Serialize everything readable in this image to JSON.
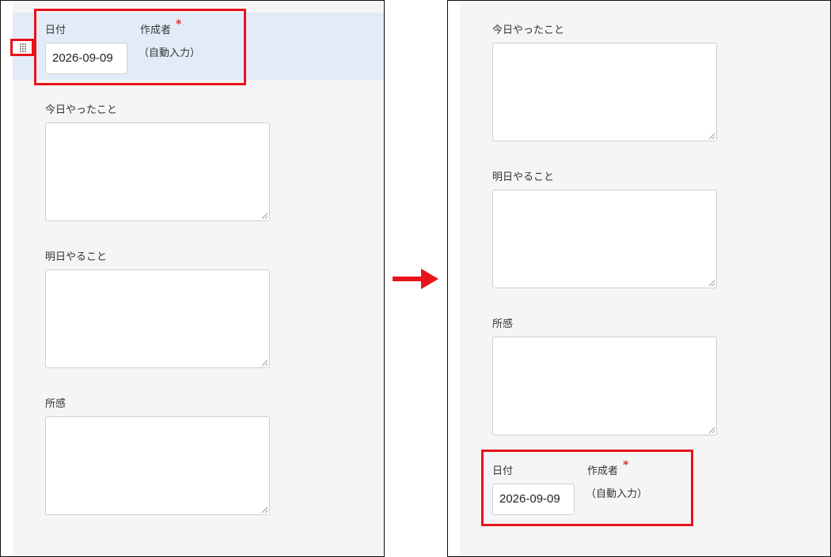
{
  "before": {
    "header_fields": {
      "date_label": "日付",
      "date_value": "2026-09-09",
      "author_label": "作成者",
      "required_mark": "*",
      "author_value": "（自動入力）"
    },
    "fields": [
      {
        "label": "今日やったこと"
      },
      {
        "label": "明日やること"
      },
      {
        "label": "所感"
      }
    ]
  },
  "after": {
    "fields": [
      {
        "label": "今日やったこと"
      },
      {
        "label": "明日やること"
      },
      {
        "label": "所感"
      }
    ],
    "header_fields": {
      "date_label": "日付",
      "date_value": "2026-09-09",
      "author_label": "作成者",
      "required_mark": "*",
      "author_value": "（自動入力）"
    }
  },
  "colors": {
    "highlight_border": "#e8131b",
    "required_mark": "#e8312c",
    "row_highlight": "#e1ecf8",
    "form_background": "#f5f5f5"
  },
  "icons": {
    "drag_handle": "drag-handle-icon",
    "transition_arrow": "arrow-right-icon",
    "resize_grip": "resize-grip-icon"
  }
}
